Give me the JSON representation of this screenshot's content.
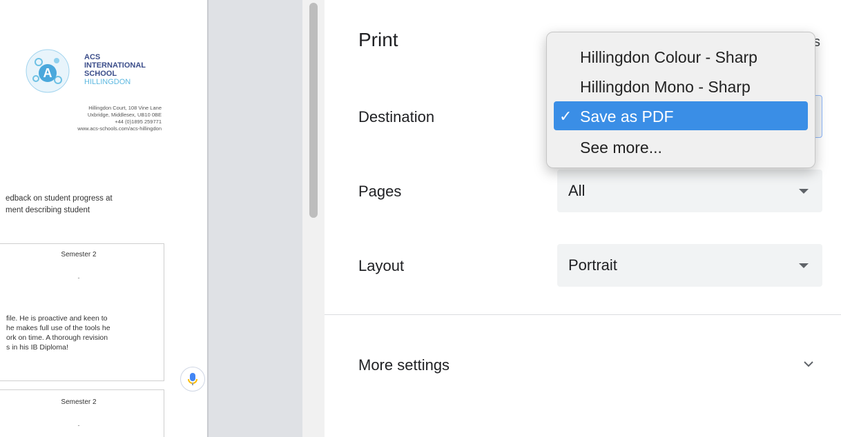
{
  "preview": {
    "school_name": [
      "ACS",
      "INTERNATIONAL",
      "SCHOOL",
      "HILLINGDON"
    ],
    "address": [
      "Hillingdon Court, 108 Vine Lane",
      "Uxbridge, Middlesex, UB10 0BE",
      "+44 (0)1895 259771",
      "www.acs-schools.com/acs-hillingdon"
    ],
    "body_text": "edback on student progress at\nment describing student",
    "box1": {
      "title": "Semester 2",
      "dash": "-",
      "text": "file. He is proactive and keen to\nhe makes full use of the tools he\nork on time. A thorough revision\ns in his IB Diploma!"
    },
    "box2": {
      "title": "Semester 2",
      "dash": "-"
    }
  },
  "settings": {
    "title": "Print",
    "sheet_count_fragment": "s",
    "destination_label": "Destination",
    "destination_value": "Save as PDF",
    "pages_label": "Pages",
    "pages_value": "All",
    "layout_label": "Layout",
    "layout_value": "Portrait",
    "more_settings_label": "More settings"
  },
  "destination_menu": {
    "items": [
      {
        "label": "Hillingdon Colour - Sharp",
        "selected": false
      },
      {
        "label": "Hillingdon Mono - Sharp",
        "selected": false
      },
      {
        "label": "Save as PDF",
        "selected": true,
        "check": "✓"
      },
      {
        "label": "See more...",
        "selected": false
      }
    ]
  },
  "colors": {
    "accent": "#3a8ee6",
    "panel_gray": "#f1f3f4",
    "gutter": "#dfe1e5"
  }
}
